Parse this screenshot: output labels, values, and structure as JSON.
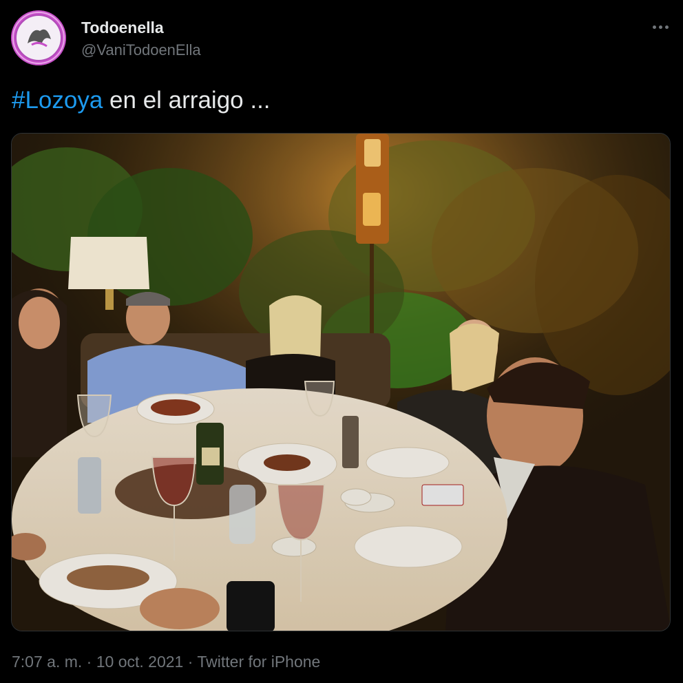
{
  "author": {
    "display_name": "Todoenella",
    "handle": "@VaniTodoenElla",
    "avatar_icon": "profile-avatar",
    "avatar_color": "#c64fc8"
  },
  "more_button": {
    "icon": "more-horizontal-icon"
  },
  "tweet": {
    "hashtag": "#Lozoya",
    "text": " en el arraigo ..."
  },
  "media": {
    "type": "photo"
  },
  "footer": {
    "time": "7:07 a. m.",
    "separator": " · ",
    "date": "10 oct. 2021",
    "separator2": " · ",
    "source": "Twitter for iPhone"
  },
  "colors": {
    "background": "#000000",
    "primary_text": "#e7e9ea",
    "secondary_text": "#71767b",
    "link": "#1d9bf0"
  }
}
